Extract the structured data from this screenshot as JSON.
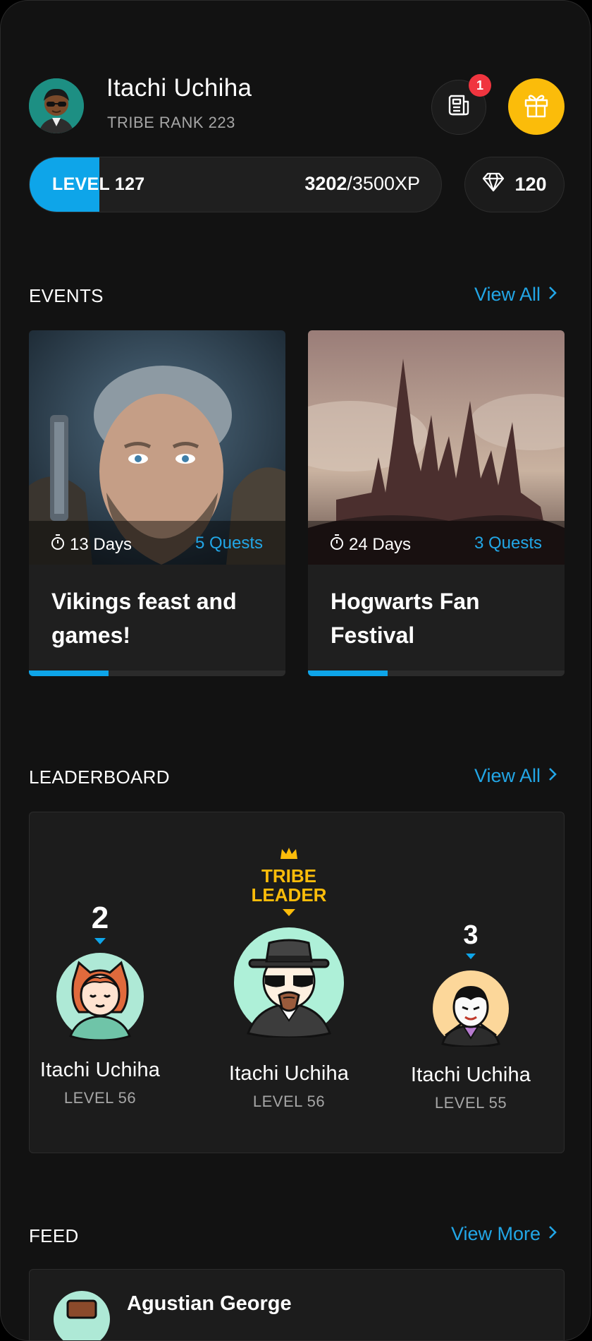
{
  "user": {
    "name": "Itachi Uchiha",
    "tribe_rank": "TRIBE RANK 223",
    "notifications": "1",
    "level_label": "LEVEL 127",
    "xp_current": "3202",
    "xp_total": "/3500XP",
    "xp_progress": 0.17,
    "gems": "120"
  },
  "events": {
    "title": "EVENTS",
    "view_all": "View All",
    "items": [
      {
        "days": "13 Days",
        "quests": "5 Quests",
        "title": "Vikings feast and games!",
        "progress": 0.31
      },
      {
        "days": "24 Days",
        "quests": "3 Quests",
        "title": "Hogwarts Fan Festival",
        "progress": 0.31
      }
    ]
  },
  "leaderboard": {
    "title": "LEADERBOARD",
    "view_all": "View All",
    "leader_badge": "TRIBE LEADER",
    "players": [
      {
        "rank": "2",
        "name": "Itachi Uchiha",
        "level": "LEVEL 56"
      },
      {
        "rank": "",
        "name": "Itachi Uchiha",
        "level": "LEVEL 56"
      },
      {
        "rank": "3",
        "name": "Itachi Uchiha",
        "level": "LEVEL 55"
      }
    ]
  },
  "feed": {
    "title": "FEED",
    "view_more": "View More",
    "items": [
      {
        "name": "Agustian George"
      }
    ]
  },
  "colors": {
    "accent": "#0ea5e9",
    "gold": "#fbbc0a",
    "badge": "#f0353f",
    "background": "#121212"
  }
}
